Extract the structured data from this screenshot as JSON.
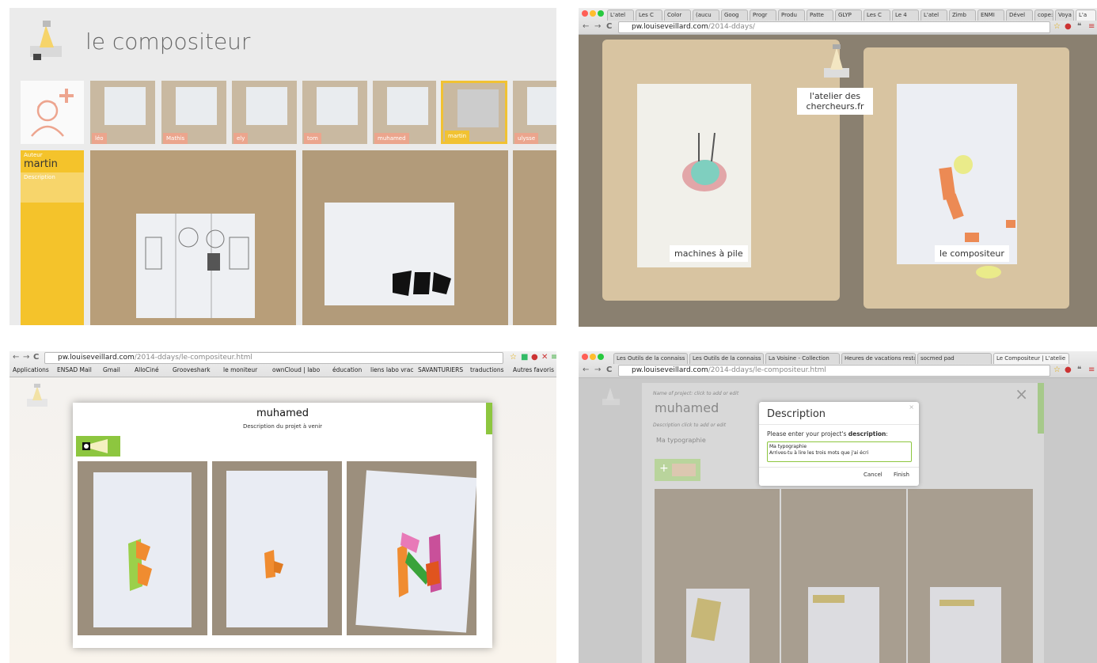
{
  "panel1": {
    "title": "le compositeur",
    "users": [
      "léo",
      "Mathis",
      "ely",
      "tom",
      "muhamed",
      "martin",
      "ulysse"
    ],
    "author_label": "Auteur",
    "author_name": "martin",
    "description_label": "Description",
    "accent_color": "#f4c32b"
  },
  "panel2": {
    "tabs": [
      "L'atel",
      "Les C",
      "Color",
      "(aucu",
      "Goog",
      "Progr",
      "Produ",
      "Patte",
      "GLYP",
      "Les C",
      "Le 4",
      "L'atel",
      "Zimb",
      "ENMI",
      "Dével",
      "cope:",
      "Voya",
      "L'a"
    ],
    "url_host": "pw.louiseveillard.com",
    "url_path": "/2014-ddays/",
    "caption_atelier": "l'atelier des chercheurs.fr",
    "caption_left": "machines à pile",
    "caption_right": "le compositeur"
  },
  "panel3": {
    "url_host": "pw.louiseveillard.com",
    "url_path": "/2014-ddays/le-compositeur.html",
    "bookmarks": [
      "Applications",
      "ENSAD Mail",
      "Gmail",
      "AlloCiné",
      "Grooveshark",
      "le moniteur",
      "ownCloud | labo",
      "éducation",
      "liens labo vrac",
      "SAVANTURIERS",
      "traductions"
    ],
    "bookmarks_more": "Autres favoris",
    "project_name": "muhamed",
    "project_subtitle": "Description du projet à venir",
    "accent_color": "#8dc63f"
  },
  "panel4": {
    "tabs": [
      "Les Outils de la connaiss",
      "Les Outils de la connaiss",
      "La Voisine - Collection",
      "Heures de vacations resta",
      "socmed pad",
      "Le Compositeur | L'atelie"
    ],
    "url_host": "pw.louiseveillard.com",
    "url_path": "/2014-ddays/le-compositeur.html",
    "name_label": "Name of project: click to add or edit",
    "project_name": "muhamed",
    "desc_label": "Description click to add or edit",
    "desc_value": "Ma typographie",
    "dialog_title": "Description",
    "dialog_prompt_prefix": "Please enter your project's ",
    "dialog_prompt_bold": "description",
    "dialog_prompt_suffix": ":",
    "textarea_value": "Ma typographie\nArrives-tu à lire les trois mots que j'ai écri",
    "cancel": "Cancel",
    "finish": "Finish",
    "close_glyph": "×"
  }
}
